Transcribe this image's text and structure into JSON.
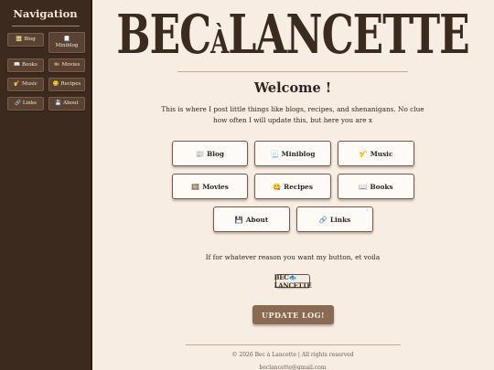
{
  "sidebar": {
    "title": "Navigation",
    "items": [
      {
        "icon": "🖼️",
        "icon_name": "frame-icon",
        "label": "Blog"
      },
      {
        "icon": "📃",
        "icon_name": "page-icon",
        "label": "Miniblog"
      },
      {
        "icon": "📖",
        "icon_name": "book-icon",
        "label": "Books"
      },
      {
        "icon": "🎞️",
        "icon_name": "film-icon",
        "label": "Movies"
      },
      {
        "icon": "🎷",
        "icon_name": "saxophone-icon",
        "label": "Music"
      },
      {
        "icon": "😋",
        "icon_name": "yum-face-icon",
        "label": "Recipes"
      },
      {
        "icon": "🔗",
        "icon_name": "link-icon",
        "label": "Links"
      },
      {
        "icon": "💾",
        "icon_name": "floppy-icon",
        "label": "About"
      }
    ]
  },
  "logo": {
    "part1": "BEC",
    "part2": "À",
    "part3": "LANCETTE"
  },
  "main": {
    "welcome": "Welcome !",
    "intro": "This is where I post little things like blogs, recipes, and shenanigans. No clue how often I will update this, but here you are x",
    "cards": [
      {
        "icon": "📰",
        "icon_name": "newspaper-icon",
        "label": "Blog"
      },
      {
        "icon": "📃",
        "icon_name": "page-icon",
        "label": "Miniblog"
      },
      {
        "icon": "🎷",
        "icon_name": "saxophone-icon",
        "label": "Music"
      },
      {
        "icon": "🎞️",
        "icon_name": "film-icon",
        "label": "Movies"
      },
      {
        "icon": "😋",
        "icon_name": "yum-face-icon",
        "label": "Recipes"
      },
      {
        "icon": "📖",
        "icon_name": "book-icon",
        "label": "Books"
      },
      {
        "icon": "💾",
        "icon_name": "floppy-icon",
        "label": "About"
      },
      {
        "icon": "🔗",
        "icon_name": "link-icon",
        "label": "Links"
      }
    ],
    "button_note": "If for whatever reason you want my button, et voila",
    "badge_text": "BEC🐟LANCETTE",
    "update_button": "UPDATE LOG!",
    "footer": "© 2026 Bec à Lancette | All rights reserved",
    "email": "beclancette@gmail.com"
  },
  "colors": {
    "sidebar": "#3d2a1f",
    "background": "#f8ede3",
    "accent": "#8a6a52"
  }
}
